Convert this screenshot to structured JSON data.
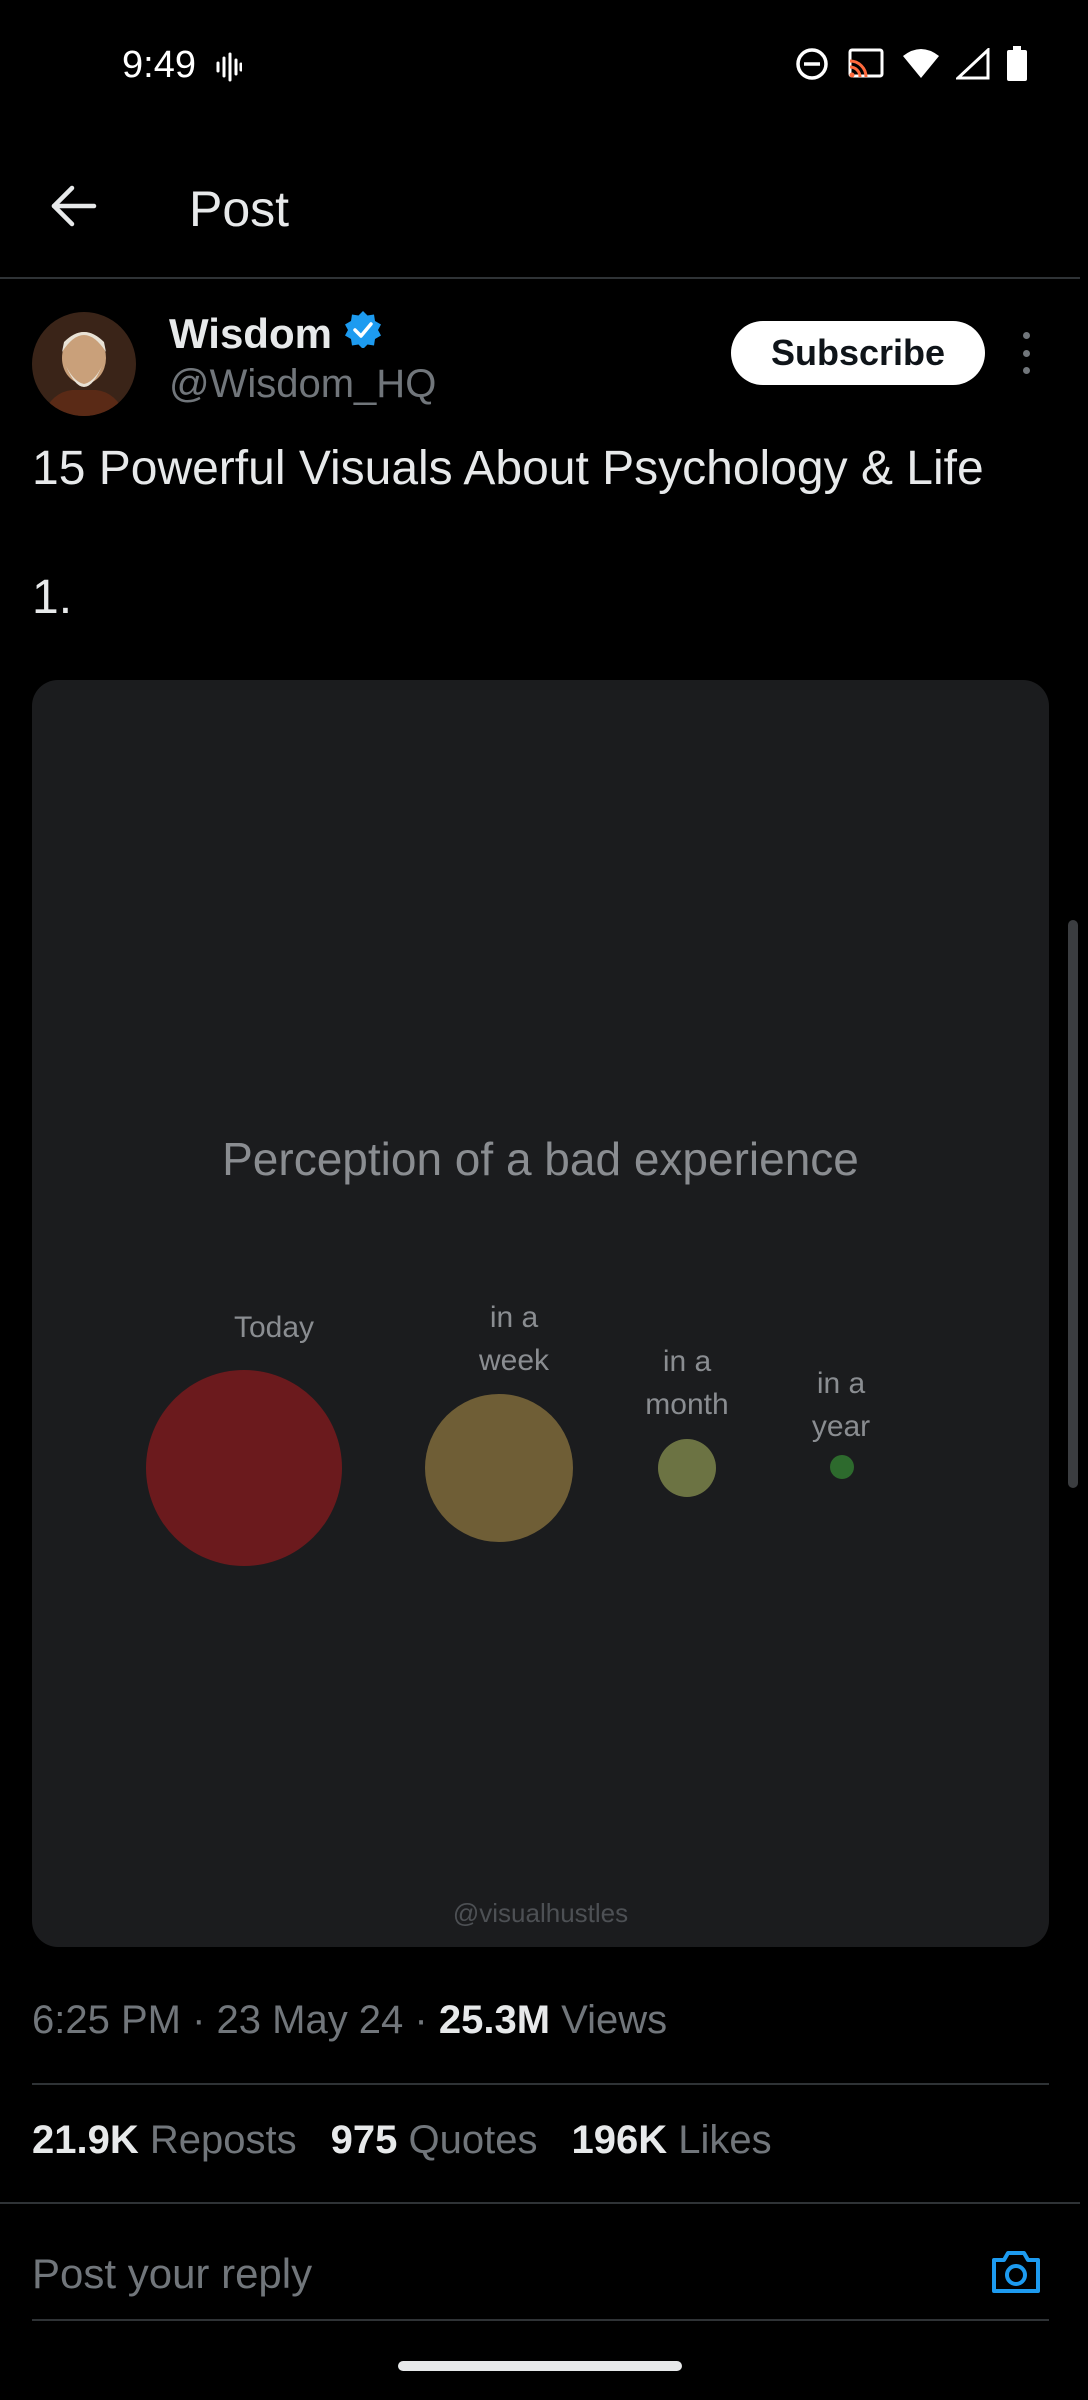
{
  "status_bar": {
    "time": "9:49"
  },
  "header": {
    "title": "Post"
  },
  "author": {
    "name": "Wisdom",
    "handle": "@Wisdom_HQ",
    "verified": true,
    "subscribe_label": "Subscribe"
  },
  "post": {
    "text": "15 Powerful Visuals About Psychology & Life",
    "item_number": "1."
  },
  "media": {
    "chart_title": "Perception of a bad experience",
    "watermark": "@visualhustles",
    "chart_data": {
      "type": "bubble",
      "title": "Perception of a bad experience",
      "categories": [
        "Today",
        "in a week",
        "in a month",
        "in a year"
      ],
      "labels": [
        [
          "Today"
        ],
        [
          "in a",
          "week"
        ],
        [
          "in a",
          "month"
        ],
        [
          "in a",
          " year"
        ]
      ],
      "relative_size": [
        1.0,
        0.75,
        0.3,
        0.12
      ],
      "colors": [
        "#6b1a1d",
        "#6f5e36",
        "#6c7343",
        "#2d6a2d"
      ]
    }
  },
  "meta": {
    "time": "6:25 PM",
    "date": "23 May 24",
    "views_count": "25.3M",
    "views_label": "Views"
  },
  "stats": {
    "reposts_count": "21.9K",
    "reposts_label": "Reposts",
    "quotes_count": "975",
    "quotes_label": "Quotes",
    "likes_count": "196K",
    "likes_label": "Likes"
  },
  "reply": {
    "placeholder": "Post your reply"
  },
  "colors": {
    "accent": "#1d9bf0",
    "background": "#000000"
  }
}
